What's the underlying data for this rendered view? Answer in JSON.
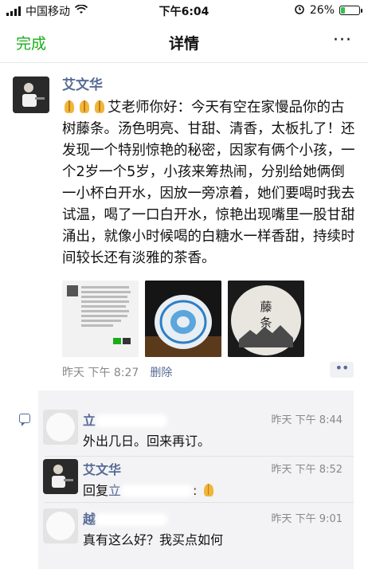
{
  "status": {
    "carrier": "中国移动",
    "time": "下午6:04",
    "battery": "26%",
    "battery_level": 0.26
  },
  "nav": {
    "left": "完成",
    "title": "详情",
    "more": "···"
  },
  "post": {
    "author": "艾文华",
    "text": "艾老师你好：今天有空在家慢品你的古树藤条。汤色明亮、甘甜、清香，太板扎了！还发现一个特别惊艳的秘密，因家有俩个小孩，一个2岁一个5岁，小孩来筹热闹，分别给她俩倒一小杯白开水，因放一旁凉着，她们要喝时我去试温，喝了一口白开水，惊艳出现嘴里一股甘甜涌出，就像小时候喝的白糖水一样香甜，持续时间较长还有淡雅的茶香。",
    "image3_label": "藤条",
    "time": "昨天 下午 8:27",
    "delete": "删除",
    "dots": "••"
  },
  "comments": [
    {
      "name": "立",
      "time": "昨天 下午 8:44",
      "text": "外出几日。回来再订。"
    },
    {
      "name": "艾文华",
      "time": "昨天 下午 8:52",
      "reply_prefix": "回复",
      "reply_to": "立",
      "text": ":"
    },
    {
      "name": "越",
      "time": "昨天 下午 9:01",
      "text": "真有这么好？我买点如何"
    }
  ]
}
